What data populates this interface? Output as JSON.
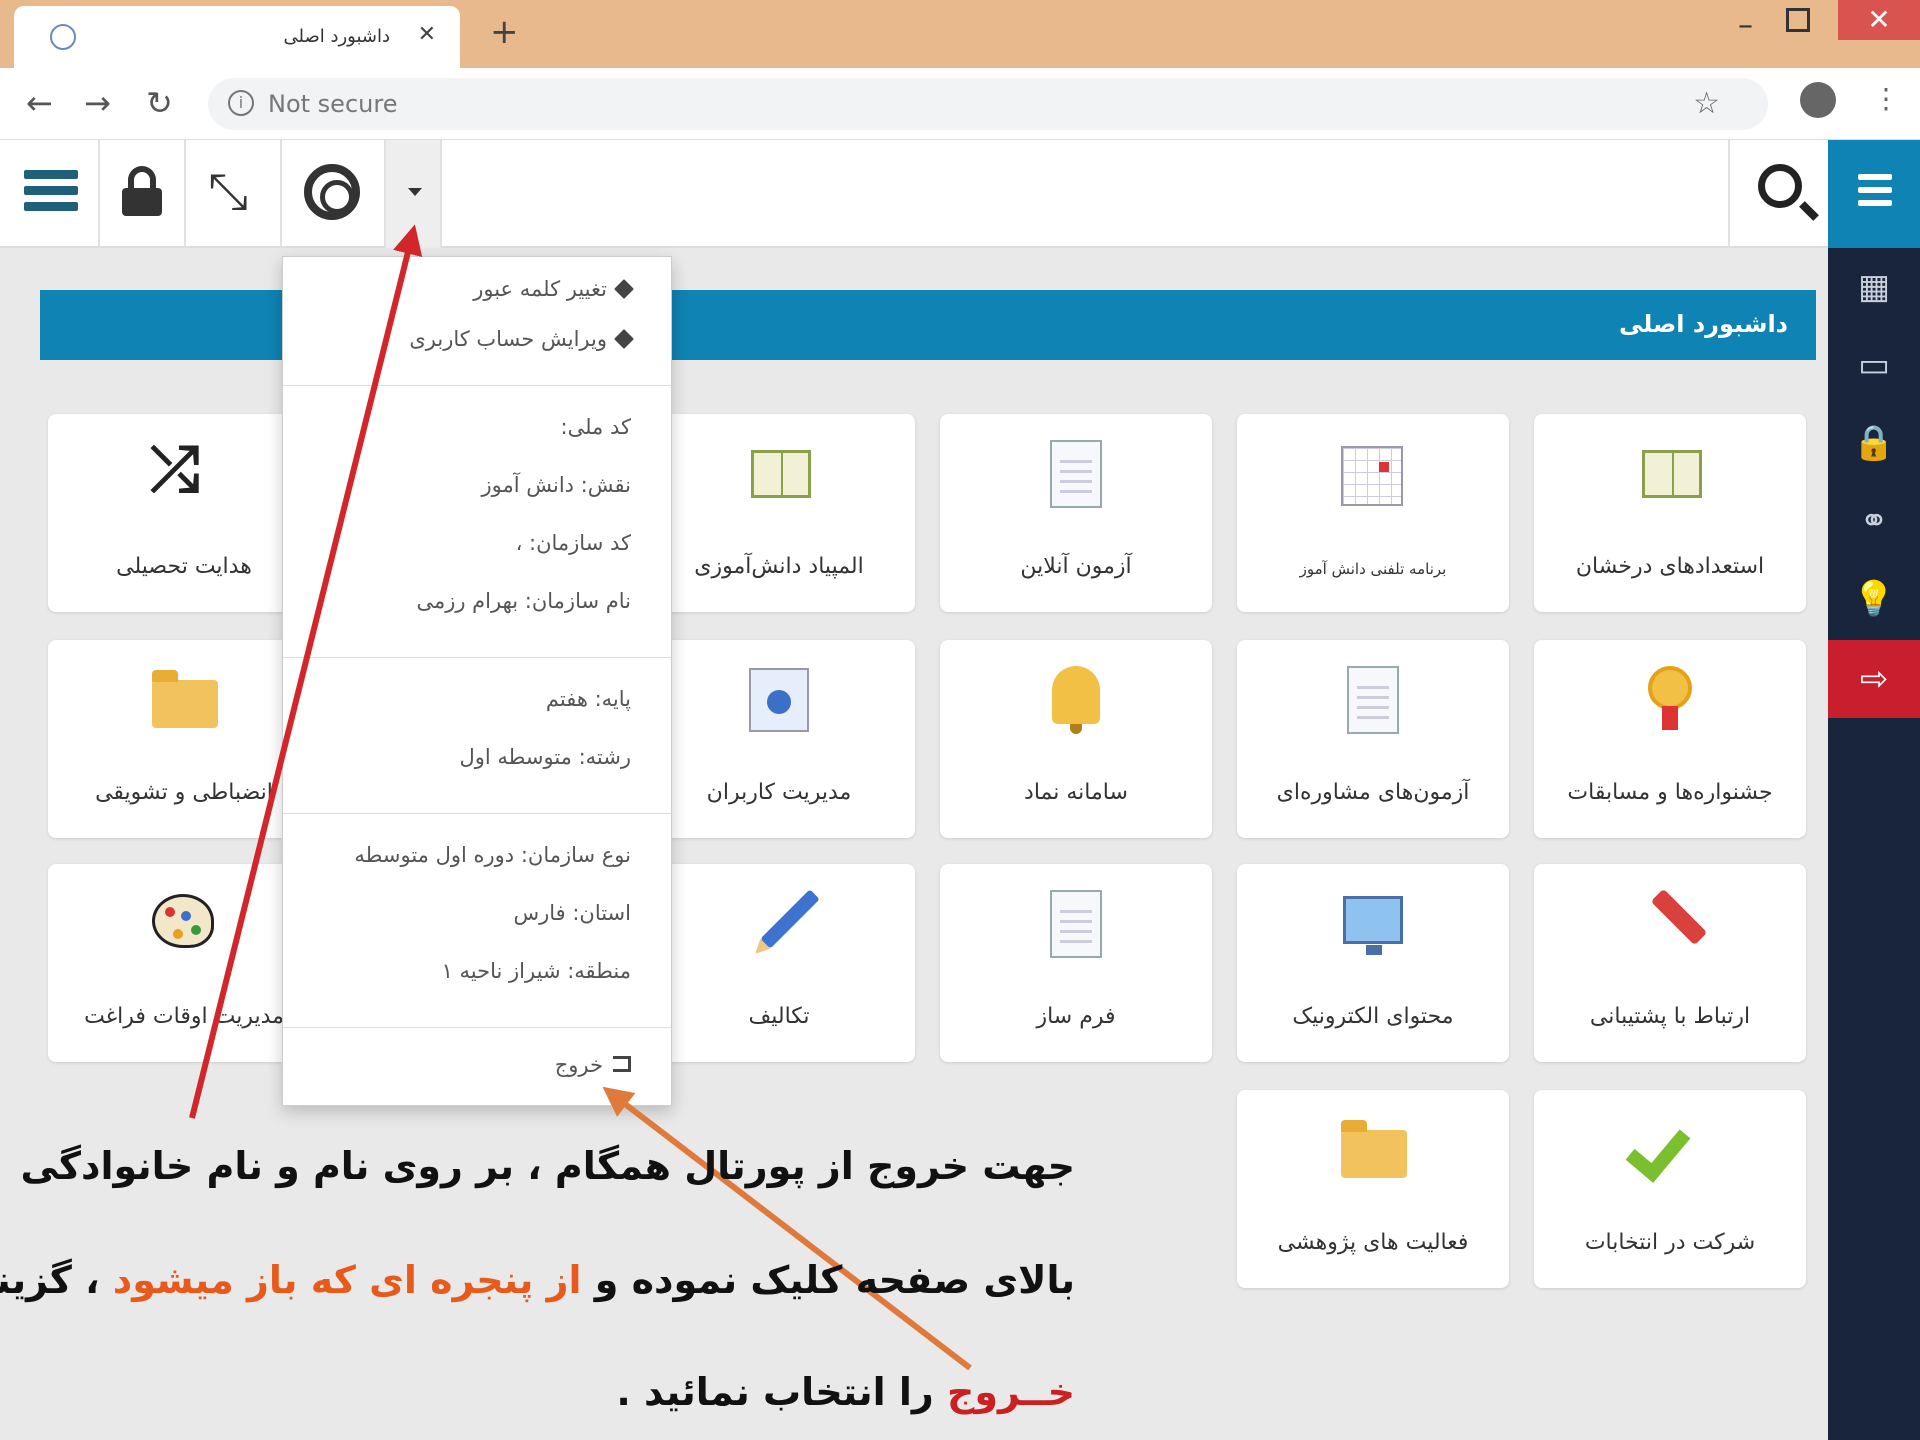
{
  "browser": {
    "tab_title": "داشبورد اصلی",
    "tab_close": "✕",
    "new_tab": "+",
    "address_security": "Not secure",
    "back": "←",
    "forward": "→",
    "reload": "↻",
    "bookmark": "☆",
    "menu": "⋮",
    "window_min": "–",
    "window_close": "✕"
  },
  "toolbar": {
    "list_icon": "list-icon",
    "lock_icon": "lock-icon",
    "fullscreen_icon": "fullscreen-icon",
    "help_icon": "lifebuoy-icon",
    "fullscreen_glyph": "⤡",
    "search_icon": "search-icon"
  },
  "sidebar": {
    "icons": [
      {
        "name": "apps-icon",
        "glyph": "▦"
      },
      {
        "name": "monitor-icon",
        "glyph": "▭"
      },
      {
        "name": "lock-icon",
        "glyph": "🔒"
      },
      {
        "name": "link-icon",
        "glyph": "⚭"
      },
      {
        "name": "bulb-icon",
        "glyph": "💡"
      },
      {
        "name": "logout-icon",
        "glyph": "⇨"
      }
    ],
    "colors": {
      "bar": "#18253c",
      "top": "#0f83b4",
      "logout": "#c81e2d"
    }
  },
  "header": {
    "title": "داشبورد اصلی",
    "color": "#0f83b4"
  },
  "tiles": {
    "r1c1": "استعدادهای درخشان",
    "r1c2": "برنامه تلفنی دانش آموز",
    "r1c3": "آزمون آنلاین",
    "r1c4": "المپیاد دانش‌آموزی",
    "r1c6": "هدایت تحصیلی",
    "r2c1": "جشنواره‌ها و مسابقات",
    "r2c2": "آزمون‌های مشاوره‌ای",
    "r2c3": "سامانه نماد",
    "r2c4": "مدیریت کاربران",
    "r2c6": "انضباطی و تشویقی",
    "r3c1": "ارتباط با پشتیبانی",
    "r3c2": "محتوای الکترونیک",
    "r3c3": "فرم ساز",
    "r3c4": "تکالیف",
    "r3c6": "مدیریت اوقات فراغت",
    "r4c1": "شرکت در انتخابات",
    "r4c2": "فعالیت های پژوهشی"
  },
  "dropdown": {
    "change_password": "تغییر کلمه عبور",
    "edit_account": "ویرایش حساب کاربری",
    "national_code": "کد ملی:",
    "role": "نقش: دانش آموز",
    "org_code": "کد سازمان: ،",
    "org_name": "نام سازمان: بهرام رزمی",
    "grade": "پایه: هفتم",
    "field": "رشته: متوسطه اول",
    "org_type": "نوع سازمان: دوره اول متوسطه",
    "province": "استان: فارس",
    "region": "منطقه: شیراز ناحیه ۱",
    "logout": "خروج"
  },
  "annotation": {
    "line1": "جهت خروج از پورتال همگام ، بر روی نام و نام خانوادگی",
    "line2_a": "بالای صفحه کلیک نموده و ",
    "line2_b": "از پنجره ای که باز میشود",
    "line2_c": " ، گزینه",
    "line3_a": "خــروج",
    "line3_b": " را انتخاب نمائید .",
    "arrow_red": "#d3262a",
    "arrow_orange": "#e07a3c"
  }
}
